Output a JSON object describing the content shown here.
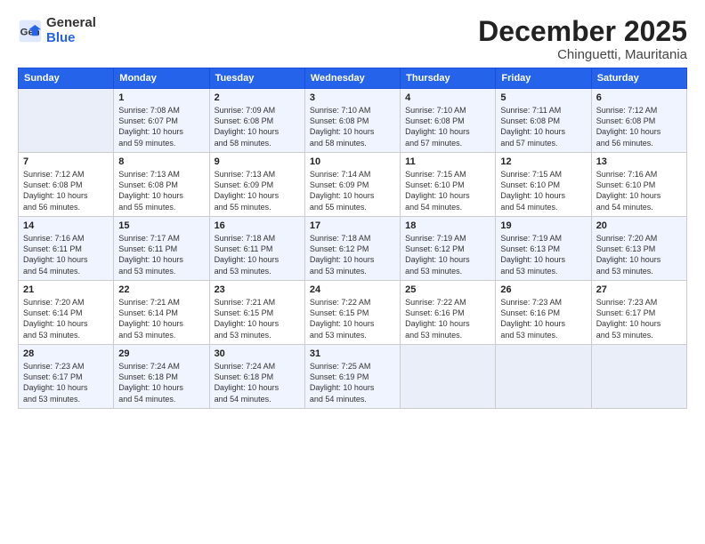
{
  "logo": {
    "general": "General",
    "blue": "Blue"
  },
  "header": {
    "month": "December 2025",
    "location": "Chinguetti, Mauritania"
  },
  "days_of_week": [
    "Sunday",
    "Monday",
    "Tuesday",
    "Wednesday",
    "Thursday",
    "Friday",
    "Saturday"
  ],
  "weeks": [
    [
      {
        "day": "",
        "empty": true
      },
      {
        "day": "1",
        "sunrise": "7:08 AM",
        "sunset": "6:07 PM",
        "daylight": "10 hours and 59 minutes."
      },
      {
        "day": "2",
        "sunrise": "7:09 AM",
        "sunset": "6:08 PM",
        "daylight": "10 hours and 58 minutes."
      },
      {
        "day": "3",
        "sunrise": "7:10 AM",
        "sunset": "6:08 PM",
        "daylight": "10 hours and 58 minutes."
      },
      {
        "day": "4",
        "sunrise": "7:10 AM",
        "sunset": "6:08 PM",
        "daylight": "10 hours and 57 minutes."
      },
      {
        "day": "5",
        "sunrise": "7:11 AM",
        "sunset": "6:08 PM",
        "daylight": "10 hours and 57 minutes."
      },
      {
        "day": "6",
        "sunrise": "7:12 AM",
        "sunset": "6:08 PM",
        "daylight": "10 hours and 56 minutes."
      }
    ],
    [
      {
        "day": "7",
        "sunrise": "7:12 AM",
        "sunset": "6:08 PM",
        "daylight": "10 hours and 56 minutes."
      },
      {
        "day": "8",
        "sunrise": "7:13 AM",
        "sunset": "6:08 PM",
        "daylight": "10 hours and 55 minutes."
      },
      {
        "day": "9",
        "sunrise": "7:13 AM",
        "sunset": "6:09 PM",
        "daylight": "10 hours and 55 minutes."
      },
      {
        "day": "10",
        "sunrise": "7:14 AM",
        "sunset": "6:09 PM",
        "daylight": "10 hours and 55 minutes."
      },
      {
        "day": "11",
        "sunrise": "7:15 AM",
        "sunset": "6:10 PM",
        "daylight": "10 hours and 54 minutes."
      },
      {
        "day": "12",
        "sunrise": "7:15 AM",
        "sunset": "6:10 PM",
        "daylight": "10 hours and 54 minutes."
      },
      {
        "day": "13",
        "sunrise": "7:16 AM",
        "sunset": "6:10 PM",
        "daylight": "10 hours and 54 minutes."
      }
    ],
    [
      {
        "day": "14",
        "sunrise": "7:16 AM",
        "sunset": "6:11 PM",
        "daylight": "10 hours and 54 minutes."
      },
      {
        "day": "15",
        "sunrise": "7:17 AM",
        "sunset": "6:11 PM",
        "daylight": "10 hours and 53 minutes."
      },
      {
        "day": "16",
        "sunrise": "7:18 AM",
        "sunset": "6:11 PM",
        "daylight": "10 hours and 53 minutes."
      },
      {
        "day": "17",
        "sunrise": "7:18 AM",
        "sunset": "6:12 PM",
        "daylight": "10 hours and 53 minutes."
      },
      {
        "day": "18",
        "sunrise": "7:19 AM",
        "sunset": "6:12 PM",
        "daylight": "10 hours and 53 minutes."
      },
      {
        "day": "19",
        "sunrise": "7:19 AM",
        "sunset": "6:13 PM",
        "daylight": "10 hours and 53 minutes."
      },
      {
        "day": "20",
        "sunrise": "7:20 AM",
        "sunset": "6:13 PM",
        "daylight": "10 hours and 53 minutes."
      }
    ],
    [
      {
        "day": "21",
        "sunrise": "7:20 AM",
        "sunset": "6:14 PM",
        "daylight": "10 hours and 53 minutes."
      },
      {
        "day": "22",
        "sunrise": "7:21 AM",
        "sunset": "6:14 PM",
        "daylight": "10 hours and 53 minutes."
      },
      {
        "day": "23",
        "sunrise": "7:21 AM",
        "sunset": "6:15 PM",
        "daylight": "10 hours and 53 minutes."
      },
      {
        "day": "24",
        "sunrise": "7:22 AM",
        "sunset": "6:15 PM",
        "daylight": "10 hours and 53 minutes."
      },
      {
        "day": "25",
        "sunrise": "7:22 AM",
        "sunset": "6:16 PM",
        "daylight": "10 hours and 53 minutes."
      },
      {
        "day": "26",
        "sunrise": "7:23 AM",
        "sunset": "6:16 PM",
        "daylight": "10 hours and 53 minutes."
      },
      {
        "day": "27",
        "sunrise": "7:23 AM",
        "sunset": "6:17 PM",
        "daylight": "10 hours and 53 minutes."
      }
    ],
    [
      {
        "day": "28",
        "sunrise": "7:23 AM",
        "sunset": "6:17 PM",
        "daylight": "10 hours and 53 minutes."
      },
      {
        "day": "29",
        "sunrise": "7:24 AM",
        "sunset": "6:18 PM",
        "daylight": "10 hours and 54 minutes."
      },
      {
        "day": "30",
        "sunrise": "7:24 AM",
        "sunset": "6:18 PM",
        "daylight": "10 hours and 54 minutes."
      },
      {
        "day": "31",
        "sunrise": "7:25 AM",
        "sunset": "6:19 PM",
        "daylight": "10 hours and 54 minutes."
      },
      {
        "day": "",
        "empty": true
      },
      {
        "day": "",
        "empty": true
      },
      {
        "day": "",
        "empty": true
      }
    ]
  ]
}
